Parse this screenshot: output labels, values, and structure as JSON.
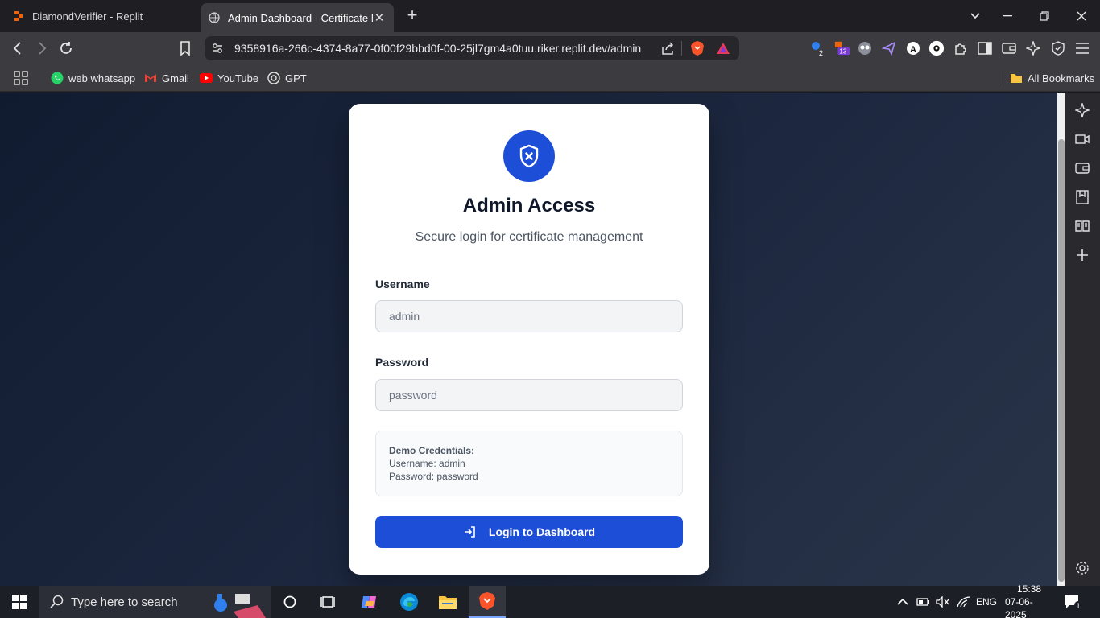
{
  "browser": {
    "tabs": [
      {
        "title": "DiamondVerifier - Replit",
        "active": false
      },
      {
        "title": "Admin Dashboard - Certificate Management",
        "active": true
      }
    ],
    "url": "9358916a-266c-4374-8a77-0f00f29bbd0f-00-25jl7gm4a0tuu.riker.replit.dev/admin",
    "extension_badges": [
      "2",
      "13"
    ],
    "bookmarks": [
      "web whatsapp",
      "Gmail",
      "YouTube",
      "GPT"
    ],
    "all_bookmarks_label": "All Bookmarks"
  },
  "card": {
    "title": "Admin Access",
    "subtitle": "Secure login for certificate management",
    "username_label": "Username",
    "username_placeholder": "admin",
    "password_label": "Password",
    "password_placeholder": "password",
    "demo_title": "Demo Credentials:",
    "demo_username": "Username: admin",
    "demo_password": "Password: password",
    "login_label": "Login to Dashboard"
  },
  "colors": {
    "accent": "#1d4ed8",
    "background_start": "#111b30",
    "background_end": "#2a3448"
  },
  "taskbar": {
    "search_placeholder": "Type here to search",
    "language": "ENG",
    "time": "15:38",
    "date": "07-06-2025",
    "notification_count": "1"
  }
}
